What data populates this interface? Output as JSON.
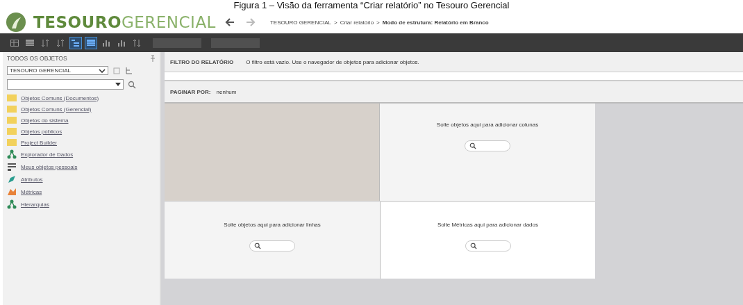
{
  "caption": "Figura 1 – Visão da ferramenta “Criar relatório” no Tesouro Gerencial",
  "header": {
    "title_primary": "TESOURO",
    "title_secondary": "GERENCIAL",
    "nav": [
      {
        "kind": "back",
        "disabled": false
      },
      {
        "kind": "forward",
        "disabled": true
      }
    ],
    "breadcrumb": [
      {
        "kind": "link",
        "label": "TESOURO GERENCIAL"
      },
      {
        "kind": "separator",
        "label": ">"
      },
      {
        "kind": "link",
        "label": "Criar relatório"
      },
      {
        "kind": "separator",
        "label": ">"
      },
      {
        "kind": "current",
        "label": "Modo de estrutura: Relatório em Branco"
      }
    ]
  },
  "toolbar": {
    "icons": [
      {
        "kind": "grid",
        "selected": false
      },
      {
        "kind": "table",
        "selected": false
      },
      {
        "kind": "sort",
        "selected": false
      },
      {
        "kind": "sort",
        "selected": false
      },
      {
        "kind": "outline",
        "selected": true
      },
      {
        "kind": "table",
        "selected": true
      },
      {
        "kind": "chart",
        "selected": false
      },
      {
        "kind": "chart",
        "selected": false
      },
      {
        "kind": "swap",
        "selected": false
      }
    ],
    "buttons": [
      {
        "disabled": true
      },
      {
        "disabled": true
      }
    ]
  },
  "sidebar": {
    "title": "TODOS OS OBJETOS",
    "source": "TESOURO GERENCIAL",
    "items": [
      {
        "kind": "folder",
        "label": "Objetos Comuns (Documentos)"
      },
      {
        "kind": "folder",
        "label": "Objetos Comuns (Gerencial)"
      },
      {
        "kind": "folder",
        "label": "Objetos do sistema"
      },
      {
        "kind": "folder",
        "label": "Objetos públicos"
      },
      {
        "kind": "folder",
        "label": "Project Builder"
      },
      {
        "kind": "explorer",
        "label": "Explorador de Dados"
      },
      {
        "kind": "mine",
        "label": "Meus objetos pessoais"
      },
      {
        "kind": "attribute",
        "label": "Atributos"
      },
      {
        "kind": "metric",
        "label": "Métricas"
      },
      {
        "kind": "hierarchy",
        "label": "Hierarquias"
      }
    ]
  },
  "report": {
    "filter_label": "FILTRO DO RELATÓRIO",
    "filter_message": "O filtro está vazio. Use o navegador de objetos para adicionar objetos.",
    "page_by_label": "PAGINAR POR:",
    "page_by_value": "nenhum",
    "zones": {
      "columns": "Solte objetos aqui para adicionar colunas",
      "rows": "Solte objetos aqui para adicionar linhas",
      "metrics": "Solte Métricas aqui para adicionar dados"
    }
  }
}
